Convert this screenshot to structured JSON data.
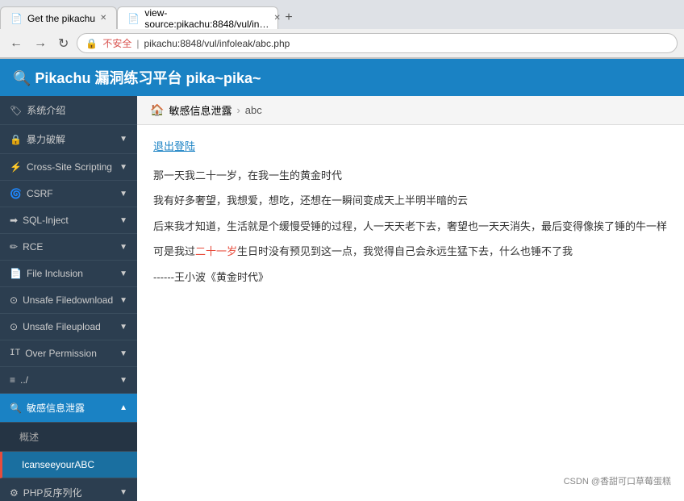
{
  "browser": {
    "tabs": [
      {
        "id": "tab1",
        "label": "Get the pikachu",
        "active": false,
        "favicon": "📄"
      },
      {
        "id": "tab2",
        "label": "view-source:pikachu:8848/vul/in…",
        "active": true,
        "favicon": "📄"
      }
    ],
    "new_tab_label": "+",
    "back_label": "←",
    "forward_label": "→",
    "refresh_label": "↻",
    "lock_label": "🔒",
    "lock_text": "不安全",
    "address": "pikachu:8848/vul/infoleak/abc.php"
  },
  "app": {
    "title": "🔍 Pikachu 漏洞练习平台 pika~pika~"
  },
  "sidebar": {
    "items": [
      {
        "id": "sys-intro",
        "icon": "🏷",
        "label": "系统介绍",
        "has_arrow": false
      },
      {
        "id": "brute-force",
        "icon": "🔒",
        "label": "暴力破解",
        "has_arrow": true
      },
      {
        "id": "xss",
        "icon": "⚡",
        "label": "Cross-Site Scripting",
        "has_arrow": true
      },
      {
        "id": "csrf",
        "icon": "🌀",
        "label": "CSRF",
        "has_arrow": true
      },
      {
        "id": "sql-inject",
        "icon": "➡",
        "label": "SQL-Inject",
        "has_arrow": true
      },
      {
        "id": "rce",
        "icon": "✏",
        "label": "RCE",
        "has_arrow": true
      },
      {
        "id": "file-inclusion",
        "icon": "📄",
        "label": "File Inclusion",
        "has_arrow": true
      },
      {
        "id": "unsafe-filedownload",
        "icon": "⊙",
        "label": "Unsafe Filedownload",
        "has_arrow": true
      },
      {
        "id": "unsafe-fileupload",
        "icon": "⊙",
        "label": "Unsafe Fileupload",
        "has_arrow": true
      },
      {
        "id": "over-permission",
        "icon": "IT",
        "label": "Over Permission",
        "has_arrow": true
      },
      {
        "id": "dir-traversal",
        "icon": "≡",
        "label": "../",
        "has_arrow": true
      },
      {
        "id": "infoleak",
        "icon": "🔍",
        "label": "敏感信息泄露",
        "has_arrow": true,
        "active": true
      }
    ],
    "sub_items": [
      {
        "id": "overview",
        "label": "概述",
        "active": false
      },
      {
        "id": "ican",
        "label": "IcanseeyourABC",
        "active": true
      }
    ],
    "more_items": [
      {
        "id": "php-deserialize",
        "icon": "⚙",
        "label": "PHP反序列化",
        "has_arrow": true
      }
    ]
  },
  "content": {
    "breadcrumb_home_icon": "🏠",
    "breadcrumb_home": "敏感信息泄露",
    "breadcrumb_sep": "›",
    "breadcrumb_current": "abc",
    "logout_label": "退出登陆",
    "paragraphs": [
      "那一天我二十一岁，在我一生的黄金时代",
      "我有好多奢望，我想爱，想吃，还想在一瞬间变成天上半明半暗的云",
      "后来我才知道，生活就是个缓慢受锤的过程，人一天天老下去，奢望也一天天消失，最后变得像挨了锤的牛一样",
      "可是我过二十一岁生日时没有预见到这一点，我觉得自己会永远生猛下去，什么也锤不了我",
      "------王小波《黄金时代》"
    ],
    "highlight_text": "二十一岁"
  },
  "watermark": {
    "text": "CSDN @香甜可口草莓蛋糕"
  }
}
